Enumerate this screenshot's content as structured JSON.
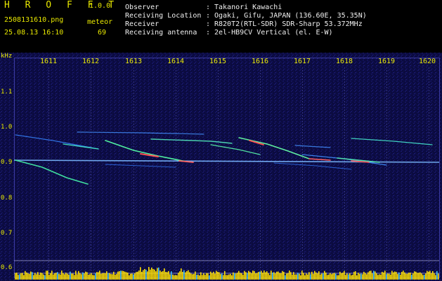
{
  "header": {
    "logo": "H R O F F T",
    "version": "1.0.0",
    "filename": "2508131610.png",
    "datetime": "25.08.13 16:10",
    "meteor_label": "meteor",
    "meteor_count": "69",
    "info": [
      {
        "key": "Observer",
        "sep": ":",
        "value": "Takanori Kawachi"
      },
      {
        "key": "Receiving Location",
        "sep": ":",
        "value": "Ogaki, Gifu, JAPAN (136.60E, 35.35N)"
      },
      {
        "key": "Receiver",
        "sep": ":",
        "value": "R820T2(RTL-SDR) SDR-Sharp 53.372MHz"
      },
      {
        "key": "Receiving antenna",
        "sep": ":",
        "value": "2el-HB9CV Vertical (el. E-W)"
      }
    ]
  },
  "spectrogram": {
    "y_unit": "kHz",
    "y_ticks": [
      "1.1",
      "1.0",
      "0.9",
      "0.8",
      "0.7",
      "0.6"
    ],
    "x_ticks": [
      "1611",
      "1612",
      "1613",
      "1614",
      "1615",
      "1616",
      "1617",
      "1618",
      "1619",
      "1620"
    ],
    "colors": {
      "background": "#0a0a3a",
      "grid": "#2a2a8a",
      "tick_text": "#e8e800",
      "carrier": "#80c0ff",
      "echo_hot": "#ff4040",
      "level_bar": "#ffe000",
      "baseline": "#c8c8ff"
    }
  }
}
